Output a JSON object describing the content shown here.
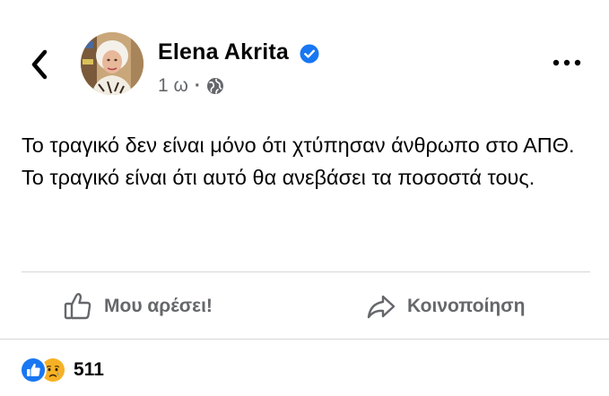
{
  "post": {
    "author": "Elena Akrita",
    "time": "1 ω",
    "meta_separator": "·",
    "privacy_icon": "globe-icon",
    "verified_icon": "verified-badge-icon",
    "lines": [
      "Το τραγικό δεν είναι μόνο ότι χτύπησαν άνθρωπο στο ΑΠΘ.",
      "Το τραγικό είναι ότι αυτό θα ανεβάσει τα ποσοστά τους."
    ]
  },
  "actions": {
    "like_label": "Μου αρέσει!",
    "share_label": "Κοινοποίηση"
  },
  "reactions": {
    "icons": [
      "like-reaction-icon",
      "sad-reaction-icon"
    ],
    "count": "511"
  },
  "colors": {
    "accent": "#1877f2",
    "secondary_text": "#65676b",
    "primary_text": "#050505",
    "divider": "#d4d6da",
    "sad_yellow": "#f7b125"
  }
}
